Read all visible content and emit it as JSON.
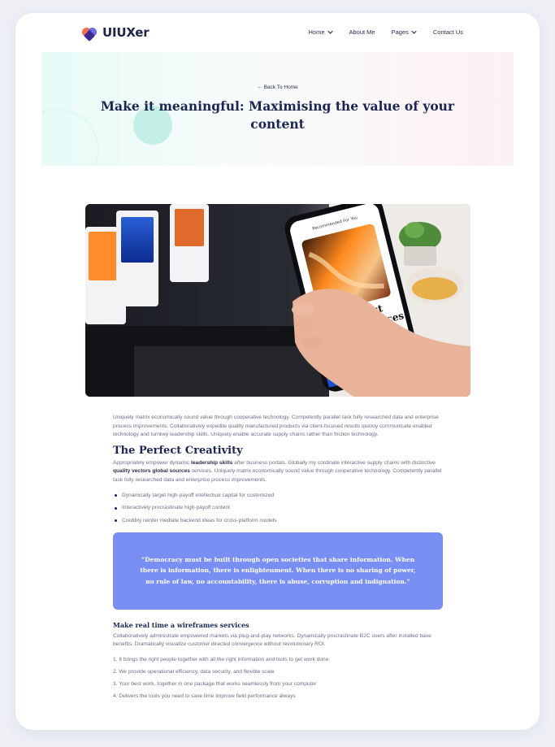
{
  "header": {
    "logo_text": "UIUXer",
    "nav": [
      {
        "label": "Home",
        "has_dropdown": true
      },
      {
        "label": "About Me",
        "has_dropdown": false
      },
      {
        "label": "Pages",
        "has_dropdown": true
      },
      {
        "label": "Contact Us",
        "has_dropdown": false
      }
    ]
  },
  "hero": {
    "back_link": "Back To Home",
    "title": "Make it meaningful: Maximising the value of your content"
  },
  "feature_image": {
    "phone_heading": "The Most Inspiring Places",
    "phone_topbar": "Recommended For You"
  },
  "article": {
    "intro": "Uniquely matrix economically sound value through cooperative technology. Competently parallel task fully researched data and enterprise process improvements. Collaboratively expedite quality manufactured products via client-focused results quickly communicate enabled technology and turnkey leadership skills. Uniquely enable accurate supply chains rather than friction technology.",
    "section_title": "The Perfect Creativity",
    "section_para": {
      "p1": "Appropriately empower dynamic ",
      "b1": "leadership skills",
      "p2": " after business portals. Globally my cordinate interactive supply chains with distinctive ",
      "b2": "quality vectors global sources",
      "p3": " services. Uniquely matrix economically sound value through cooperative technology. Competently parallel task fully researched data and ",
      "i1": "enterprise process improvements",
      "p4": "."
    },
    "bullets": [
      "Dynamically target high-payoff intellectual capital for customized",
      "Interactively procrastinate high-payoff content",
      "Credibly reinter mediate backend ideas for cross-platform models"
    ],
    "quote": "“Democracy must be built through open societies that share information. When there is information, there is enlightenment. When there is no sharing of power, no rule of law, no accountability, there is abuse, corruption and indignation.”",
    "subsection_title": "Make real time a wireframes services",
    "subsection_para": "Collaboratively administrate empowered markets via plug-and-play networks. Dynamically procrastinate B2C users after installed base benefits. Dramatically visualize customer directed convergence without revolutionary ROI.",
    "numbered": [
      "1. It brings the right people together with all the right information and tools to get work done",
      "2. We provide operational efficiency, data security, and flexible scale",
      "3. Your best work, together in one package that works seamlessly from your computer",
      "4. Delivers the tools you need to save time Improve field performance always"
    ]
  }
}
